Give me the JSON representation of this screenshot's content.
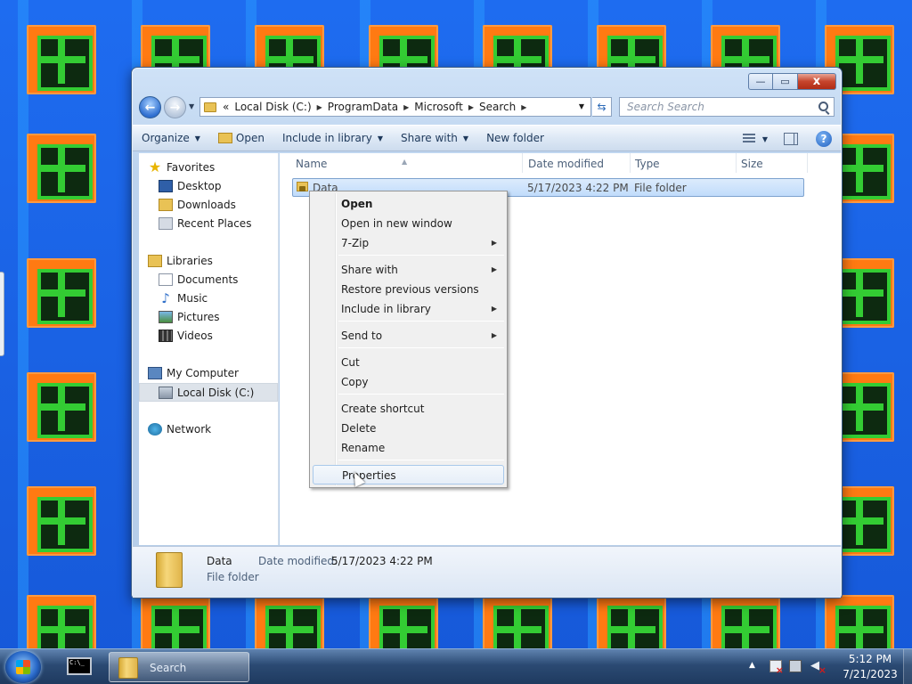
{
  "window": {
    "caption_buttons": {
      "minimize": "—",
      "maximize": "▭",
      "close": "x"
    }
  },
  "navigation": {
    "back_glyph": "←",
    "forward_glyph": "→",
    "address_prefix": "«",
    "breadcrumbs": [
      "Local Disk (C:)",
      "ProgramData",
      "Microsoft",
      "Search"
    ],
    "search_placeholder": "Search Search"
  },
  "toolbar": {
    "organize": "Organize",
    "open": "Open",
    "include_in_library": "Include in library",
    "share_with": "Share with",
    "new_folder": "New folder",
    "help": "?"
  },
  "nav_pane": {
    "favorites": "Favorites",
    "desktop": "Desktop",
    "downloads": "Downloads",
    "recent_places": "Recent Places",
    "libraries": "Libraries",
    "documents": "Documents",
    "music": "Music",
    "pictures": "Pictures",
    "videos": "Videos",
    "my_computer": "My Computer",
    "local_disk": "Local Disk (C:)",
    "network": "Network"
  },
  "columns": {
    "name": "Name",
    "date_modified": "Date modified",
    "type": "Type",
    "size": "Size"
  },
  "files": [
    {
      "name": "Data",
      "date_modified": "5/17/2023 4:22 PM",
      "type": "File folder",
      "size": ""
    }
  ],
  "context_menu": {
    "open": "Open",
    "open_new_window": "Open in new window",
    "seven_zip": "7-Zip",
    "share_with": "Share with",
    "restore_previous_versions": "Restore previous versions",
    "include_in_library": "Include in library",
    "send_to": "Send to",
    "cut": "Cut",
    "copy": "Copy",
    "create_shortcut": "Create shortcut",
    "delete": "Delete",
    "rename": "Rename",
    "properties": "Properties"
  },
  "details_pane": {
    "name": "Data",
    "type": "File folder",
    "date_modified_label": "Date modified:",
    "date_modified_value": "5/17/2023 4:22 PM"
  },
  "taskbar": {
    "cmd_text": "C:\\_",
    "explorer_label": "Search",
    "clock_time": "5:12 PM",
    "clock_date": "7/21/2023"
  }
}
